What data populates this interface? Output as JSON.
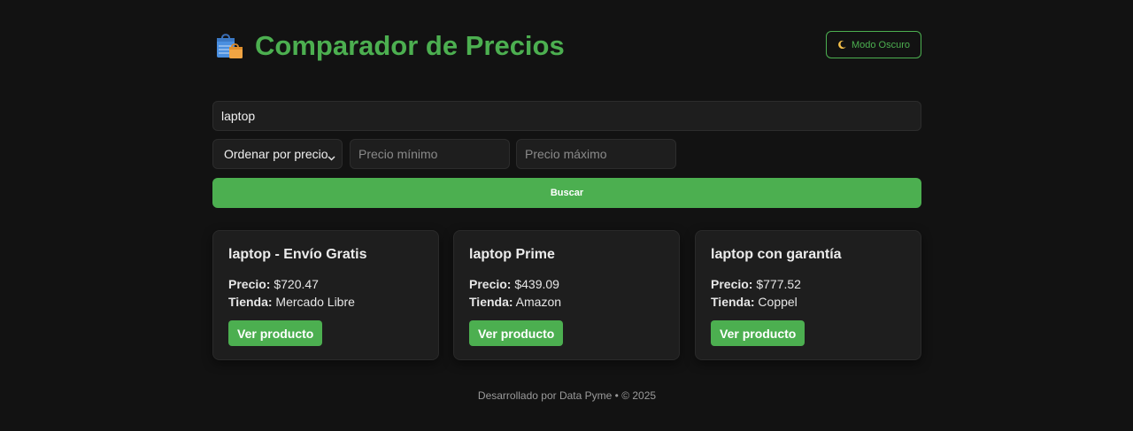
{
  "header": {
    "title": "Comparador de Precios",
    "logo_icon": "shopping-bags-icon",
    "dark_mode_label": "Modo Oscuro",
    "dark_mode_icon": "crescent-moon-icon"
  },
  "search": {
    "value": "laptop"
  },
  "filters": {
    "sort_selected": "Ordenar por precio",
    "min_price_placeholder": "Precio mínimo",
    "max_price_placeholder": "Precio máximo"
  },
  "search_button_label": "Buscar",
  "labels": {
    "price": "Precio:",
    "store": "Tienda:"
  },
  "results": [
    {
      "name": "laptop - Envío Gratis",
      "price": "$720.47",
      "store": "Mercado Libre",
      "button": "Ver producto"
    },
    {
      "name": "laptop Prime",
      "price": "$439.09",
      "store": "Amazon",
      "button": "Ver producto"
    },
    {
      "name": "laptop con garantía",
      "price": "$777.52",
      "store": "Coppel",
      "button": "Ver producto"
    }
  ],
  "footer": {
    "text": "Desarrollado por Data Pyme • © 2025"
  },
  "colors": {
    "background": "#121212",
    "surface": "#1e1e1e",
    "accent": "#4caf50",
    "muted_text": "#9a9a9a"
  }
}
